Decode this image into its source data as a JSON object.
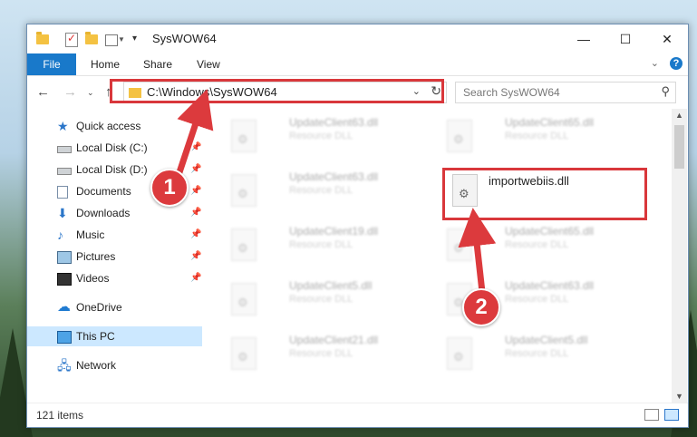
{
  "window": {
    "title": "SysWOW64"
  },
  "controls": {
    "minimize": "—",
    "maximize": "☐",
    "close": "✕"
  },
  "ribbon": {
    "tabs": [
      "File",
      "Home",
      "Share",
      "View"
    ]
  },
  "navigation": {
    "address": "C:\\Windows\\SysWOW64",
    "search_placeholder": "Search SysWOW64"
  },
  "sidebar": {
    "items": [
      {
        "label": "Quick access",
        "icon": "star-icon",
        "pinned": false
      },
      {
        "label": "Local Disk (C:)",
        "icon": "disk-icon",
        "pinned": true
      },
      {
        "label": "Local Disk (D:)",
        "icon": "disk-icon",
        "pinned": true
      },
      {
        "label": "Documents",
        "icon": "documents-icon",
        "pinned": true
      },
      {
        "label": "Downloads",
        "icon": "download-icon",
        "pinned": true
      },
      {
        "label": "Music",
        "icon": "music-icon",
        "pinned": true
      },
      {
        "label": "Pictures",
        "icon": "pictures-icon",
        "pinned": true
      },
      {
        "label": "Videos",
        "icon": "videos-icon",
        "pinned": true
      },
      {
        "label": "OneDrive",
        "icon": "cloud-icon",
        "pinned": false
      },
      {
        "label": "This PC",
        "icon": "computer-icon",
        "pinned": false,
        "selected": true
      },
      {
        "label": "Network",
        "icon": "network-icon",
        "pinned": false
      }
    ]
  },
  "files": [
    {
      "name": "UpdateClient63.dll",
      "type": "Resource DLL"
    },
    {
      "name": "UpdateClient65.dll",
      "type": "Resource DLL"
    },
    {
      "name": "UpdateClient63.dll",
      "type": "Resource DLL"
    },
    {
      "name": "importwebiis.dll",
      "type": ""
    },
    {
      "name": "UpdateClient19.dll",
      "type": "Resource DLL"
    },
    {
      "name": "UpdateClient65.dll",
      "type": "Resource DLL"
    },
    {
      "name": "UpdateClient5.dll",
      "type": "Resource DLL"
    },
    {
      "name": "UpdateClient63.dll",
      "type": "Resource DLL"
    },
    {
      "name": "UpdateClient21.dll",
      "type": "Resource DLL"
    },
    {
      "name": "UpdateClient5.dll",
      "type": "Resource DLL"
    }
  ],
  "status": {
    "item_count": "121 items"
  },
  "annotations": {
    "step1": "1",
    "step2": "2",
    "color": "#dc3a3d"
  }
}
